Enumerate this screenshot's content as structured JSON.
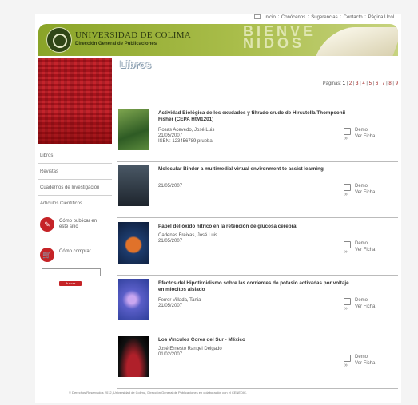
{
  "topnav": {
    "links": [
      "Inicio",
      "Conócenos",
      "Sugerencias",
      "Contacto",
      "Página Ucol"
    ]
  },
  "header": {
    "university": "UNIVERSIDAD DE COLIMA",
    "department": "Dirección General de Publicaciones",
    "welcome_line1": "BIENVE",
    "welcome_line2": "NIDOS",
    "brand_color": "#8aa428"
  },
  "sidebar": {
    "links": [
      "Libros",
      "Revistas",
      "Cuadernos de Investigación",
      "Artículos Científicos"
    ],
    "promos": [
      {
        "label": "Cómo publicar en este sitio",
        "icon": "pencil-icon"
      },
      {
        "label": "Cómo comprar",
        "icon": "cart-icon"
      }
    ],
    "search": {
      "value": "",
      "button": "Buscar"
    },
    "accent_color": "#c52327"
  },
  "main": {
    "section_title": "Libros",
    "pager": {
      "label": "Páginas:",
      "pages": [
        "1",
        "2",
        "3",
        "4",
        "5",
        "6",
        "7",
        "8",
        "9"
      ],
      "current": "1"
    },
    "books": [
      {
        "title": "Actividad Biológica de los exudados y filtrado crudo de Hirsutella Thompsonii Fisher (CEPA HtM1201)",
        "author": "Rosas Acevedo, José Luis",
        "date": "21/05/2007",
        "extra": "ISBN: 123456789 prueba",
        "demo": "Demo",
        "ficha": "Ver Ficha",
        "cover_color": "#4a7a36"
      },
      {
        "title": "Molecular Binder a multimedial virtual environment to assist learning",
        "author": "",
        "date": "21/05/2007",
        "extra": "",
        "demo": "Demo",
        "ficha": "Ver Ficha",
        "cover_color": "#2e3b4a"
      },
      {
        "title": "Papel del óxido nítrico en la retención de glucosa cerebral",
        "author": "Cadenas Freixas, José Luis",
        "date": "21/05/2007",
        "extra": "",
        "demo": "Demo",
        "ficha": "Ver Ficha",
        "cover_color": "#1d3c6e"
      },
      {
        "title": "Efectos del Hipotiroidismo sobre las corrientes de potasio activadas por voltaje en miocitos aislado",
        "author": "Ferrer Villada, Tania",
        "date": "21/05/2007",
        "extra": "",
        "demo": "Demo",
        "ficha": "Ver Ficha",
        "cover_color": "#3b56a8"
      },
      {
        "title": "Los Vínculos Corea del Sur - México",
        "author": "José Ernesto Rangel Delgado",
        "date": "01/02/2007",
        "extra": "",
        "demo": "Demo",
        "ficha": "Ver Ficha",
        "cover_color": "#1a1a1a"
      }
    ]
  },
  "footer": {
    "text": "® Derechos Reservados 2012, Universidad de Colima, Dirección General de Publicaciones en colaboración con el CENEDIC."
  }
}
